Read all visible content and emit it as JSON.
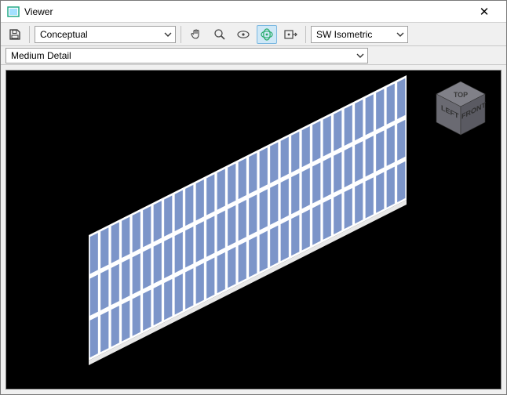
{
  "window": {
    "title": "Viewer"
  },
  "toolbar": {
    "visual_style": "Conceptual",
    "view_orientation": "SW Isometric"
  },
  "detail": {
    "level": "Medium Detail"
  },
  "viewcube": {
    "top": "TOP",
    "left": "LEFT",
    "front": "FRONT"
  },
  "icons": {
    "save": "save-icon",
    "pan": "pan-icon",
    "zoom": "zoom-icon",
    "orbit_constrained": "orbit-constrained-icon",
    "orbit_free": "orbit-free-icon",
    "steering_wheel": "steering-wheel-icon"
  },
  "colors": {
    "panel_fill": "#7C95C9",
    "panel_edge": "#ffffff",
    "viewcube_light": "#808088",
    "viewcube_mid": "#6a6a72",
    "viewcube_dark": "#5a5a62",
    "viewcube_text": "#3a3a3a"
  }
}
